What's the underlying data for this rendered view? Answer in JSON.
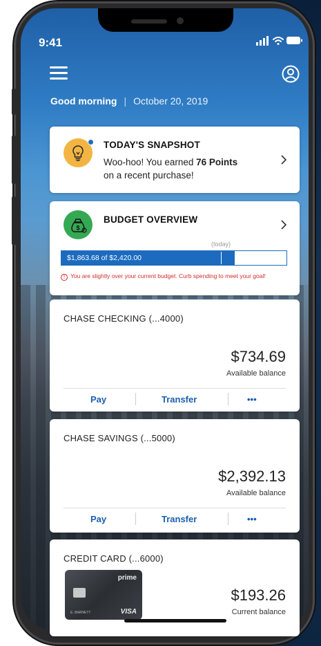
{
  "status": {
    "time": "9:41"
  },
  "greeting": {
    "salutation": "Good morning",
    "separator": "|",
    "date": "October 20, 2019"
  },
  "snapshot": {
    "title": "TODAY'S SNAPSHOT",
    "line1_prefix": "Woo-hoo! You earned ",
    "line1_bold": "76 Points",
    "line2": "on a recent purchase!",
    "icon": "lightbulb-icon"
  },
  "budget": {
    "title": "BUDGET OVERVIEW",
    "today_label": "(today)",
    "amount_text": "$1,863.68 of $2,420.00",
    "spent": 1863.68,
    "total": 2420.0,
    "warning": "You are slightly over your current budget. Curb spending to meet your goal!",
    "icon": "money-bag-icon"
  },
  "accounts": [
    {
      "name": "CHASE CHECKING (...4000)",
      "balance": "$734.69",
      "balance_label": "Available balance",
      "actions": [
        "Pay",
        "Transfer",
        "•••"
      ]
    },
    {
      "name": "CHASE SAVINGS (...5000)",
      "balance": "$2,392.13",
      "balance_label": "Available balance",
      "actions": [
        "Pay",
        "Transfer",
        "•••"
      ]
    },
    {
      "name": "CREDIT CARD (...6000)",
      "balance": "$193.26",
      "balance_label": "Current balance",
      "card": {
        "brand_top": "prime",
        "brand_bottom": "VISA",
        "owner": "E. BARNETT"
      }
    }
  ],
  "colors": {
    "chase_blue": "#1a5fad",
    "warning_red": "#d42a2a",
    "budget_bar": "#1c6bbf"
  }
}
